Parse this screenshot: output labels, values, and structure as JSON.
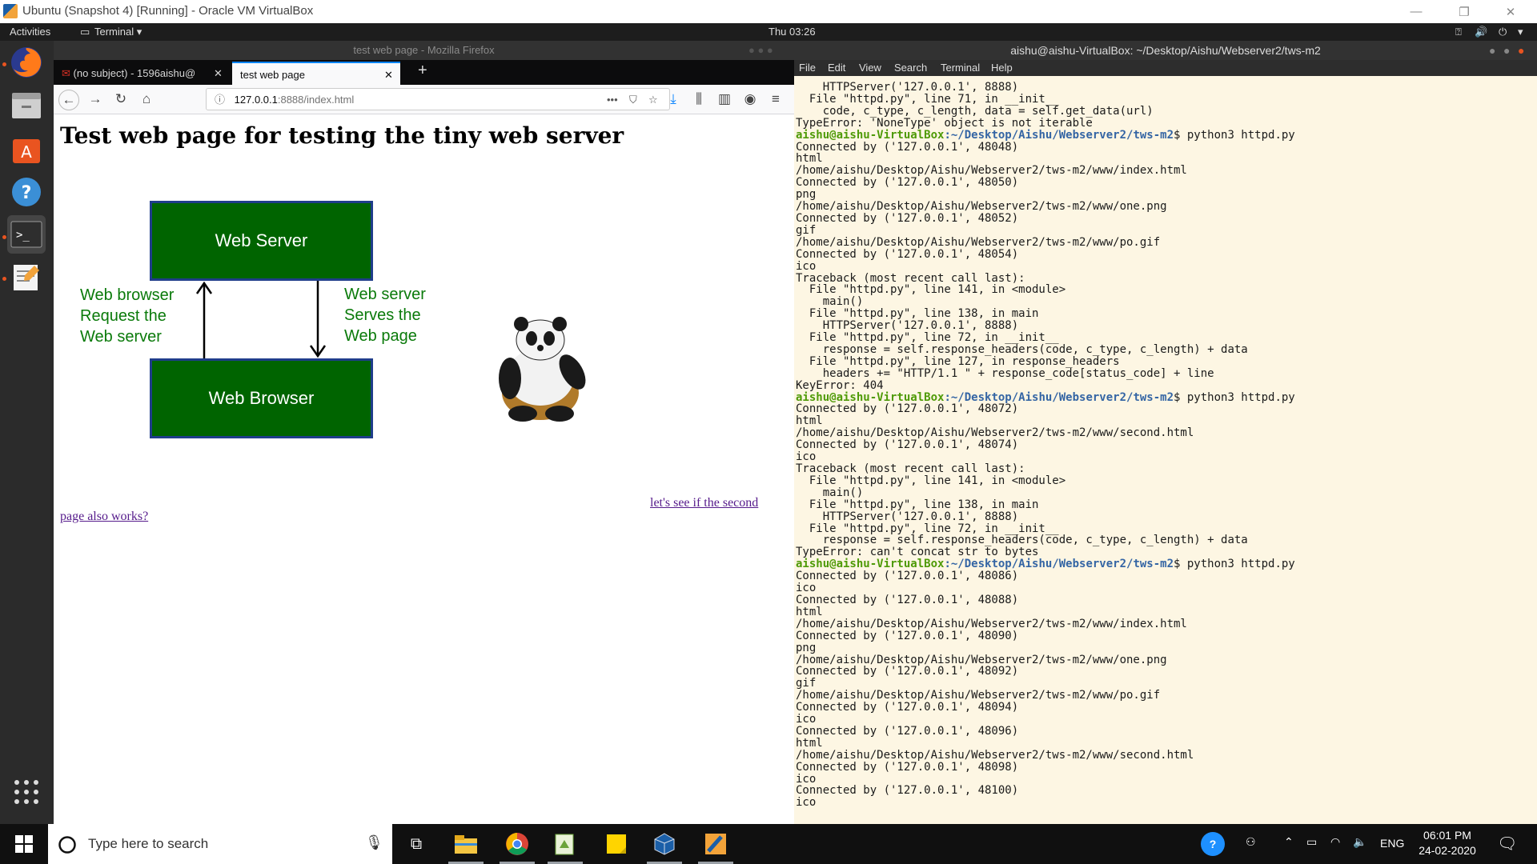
{
  "vbox": {
    "title": "Ubuntu (Snapshot 4) [Running] - Oracle VM VirtualBox",
    "minimize": "—",
    "restore": "❐",
    "close": "✕"
  },
  "ubuntu": {
    "activities": "Activities",
    "app_menu": "Terminal",
    "clock": "Thu 03:26"
  },
  "firefox": {
    "window_title": "test web page - Mozilla Firefox",
    "tabs": [
      {
        "label": "(no subject) - 1596aishu@"
      },
      {
        "label": "test web page"
      }
    ],
    "new_tab": "+",
    "url_host": "127.0.0.1",
    "url_rest": ":8888/index.html",
    "page": {
      "heading": "Test web page for testing the tiny web server",
      "box_server": "Web Server",
      "box_browser": "Web Browser",
      "label_left": [
        "Web browser",
        "Request the",
        "Web server"
      ],
      "label_right": [
        "Web server",
        "Serves the",
        "Web page"
      ],
      "link_part1": "let's see if the second",
      "link_part2": "page also works?"
    }
  },
  "terminal": {
    "window_title": "aishu@aishu-VirtualBox: ~/Desktop/Aishu/Webserver2/tws-m2",
    "menu": [
      "File",
      "Edit",
      "View",
      "Search",
      "Terminal",
      "Help"
    ],
    "prompt_user": "aishu@aishu-VirtualBox",
    "prompt_path": ":~/Desktop/Aishu/Webserver2/tws-m2",
    "prompt_cmd": "$ python3 httpd.py",
    "lines": [
      {
        "t": "    HTTPServer('127.0.0.1', 8888)"
      },
      {
        "t": "  File \"httpd.py\", line 71, in __init__"
      },
      {
        "t": "    code, c_type, c_length, data = self.get_data(url)"
      },
      {
        "t": "TypeError: 'NoneType' object is not iterable"
      },
      {
        "p": true
      },
      {
        "t": "Connected by ('127.0.0.1', 48048)"
      },
      {
        "t": "html"
      },
      {
        "t": "/home/aishu/Desktop/Aishu/Webserver2/tws-m2/www/index.html"
      },
      {
        "t": "Connected by ('127.0.0.1', 48050)"
      },
      {
        "t": "png"
      },
      {
        "t": "/home/aishu/Desktop/Aishu/Webserver2/tws-m2/www/one.png"
      },
      {
        "t": "Connected by ('127.0.0.1', 48052)"
      },
      {
        "t": "gif"
      },
      {
        "t": "/home/aishu/Desktop/Aishu/Webserver2/tws-m2/www/po.gif"
      },
      {
        "t": "Connected by ('127.0.0.1', 48054)"
      },
      {
        "t": "ico"
      },
      {
        "t": "Traceback (most recent call last):"
      },
      {
        "t": "  File \"httpd.py\", line 141, in <module>"
      },
      {
        "t": "    main()"
      },
      {
        "t": "  File \"httpd.py\", line 138, in main"
      },
      {
        "t": "    HTTPServer('127.0.0.1', 8888)"
      },
      {
        "t": "  File \"httpd.py\", line 72, in __init__"
      },
      {
        "t": "    response = self.response_headers(code, c_type, c_length) + data"
      },
      {
        "t": "  File \"httpd.py\", line 127, in response_headers"
      },
      {
        "t": "    headers += \"HTTP/1.1 \" + response_code[status_code] + line"
      },
      {
        "t": "KeyError: 404"
      },
      {
        "p": true
      },
      {
        "t": "Connected by ('127.0.0.1', 48072)"
      },
      {
        "t": "html"
      },
      {
        "t": "/home/aishu/Desktop/Aishu/Webserver2/tws-m2/www/second.html"
      },
      {
        "t": "Connected by ('127.0.0.1', 48074)"
      },
      {
        "t": "ico"
      },
      {
        "t": "Traceback (most recent call last):"
      },
      {
        "t": "  File \"httpd.py\", line 141, in <module>"
      },
      {
        "t": "    main()"
      },
      {
        "t": "  File \"httpd.py\", line 138, in main"
      },
      {
        "t": "    HTTPServer('127.0.0.1', 8888)"
      },
      {
        "t": "  File \"httpd.py\", line 72, in __init__"
      },
      {
        "t": "    response = self.response_headers(code, c_type, c_length) + data"
      },
      {
        "t": "TypeError: can't concat str to bytes"
      },
      {
        "p": true
      },
      {
        "t": "Connected by ('127.0.0.1', 48086)"
      },
      {
        "t": "ico"
      },
      {
        "t": "Connected by ('127.0.0.1', 48088)"
      },
      {
        "t": "html"
      },
      {
        "t": "/home/aishu/Desktop/Aishu/Webserver2/tws-m2/www/index.html"
      },
      {
        "t": "Connected by ('127.0.0.1', 48090)"
      },
      {
        "t": "png"
      },
      {
        "t": "/home/aishu/Desktop/Aishu/Webserver2/tws-m2/www/one.png"
      },
      {
        "t": "Connected by ('127.0.0.1', 48092)"
      },
      {
        "t": "gif"
      },
      {
        "t": "/home/aishu/Desktop/Aishu/Webserver2/tws-m2/www/po.gif"
      },
      {
        "t": "Connected by ('127.0.0.1', 48094)"
      },
      {
        "t": "ico"
      },
      {
        "t": "Connected by ('127.0.0.1', 48096)"
      },
      {
        "t": "html"
      },
      {
        "t": "/home/aishu/Desktop/Aishu/Webserver2/tws-m2/www/second.html"
      },
      {
        "t": "Connected by ('127.0.0.1', 48098)"
      },
      {
        "t": "ico"
      },
      {
        "t": "Connected by ('127.0.0.1', 48100)"
      },
      {
        "t": "ico"
      }
    ]
  },
  "taskbar": {
    "search_placeholder": "Type here to search",
    "language": "ENG",
    "time": "06:01 PM",
    "date": "24-02-2020"
  },
  "colors": {
    "diagram_green": "#006400",
    "diagram_border": "#1f3d8a",
    "terminal_bg": "#fdf6e3",
    "prompt_user": "#4e9a06",
    "prompt_path": "#3465a4"
  }
}
